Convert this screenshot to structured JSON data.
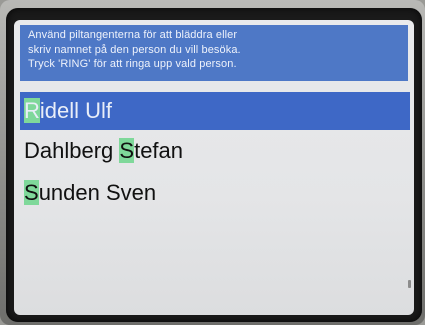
{
  "instructions": {
    "line1": "Använd piltangenterna för att bläddra eller",
    "line2": "skriv namnet på den person du vill besöka.",
    "line3": "Tryck 'RING' för att ringa upp vald person."
  },
  "contacts": [
    {
      "highlight": "R",
      "before": "",
      "after": "idell Ulf",
      "selected": true
    },
    {
      "before": "Dahlberg ",
      "highlight": "S",
      "after": "tefan",
      "selected": false
    },
    {
      "before": "",
      "highlight": "S",
      "after": "unden Sven",
      "selected": false
    }
  ]
}
